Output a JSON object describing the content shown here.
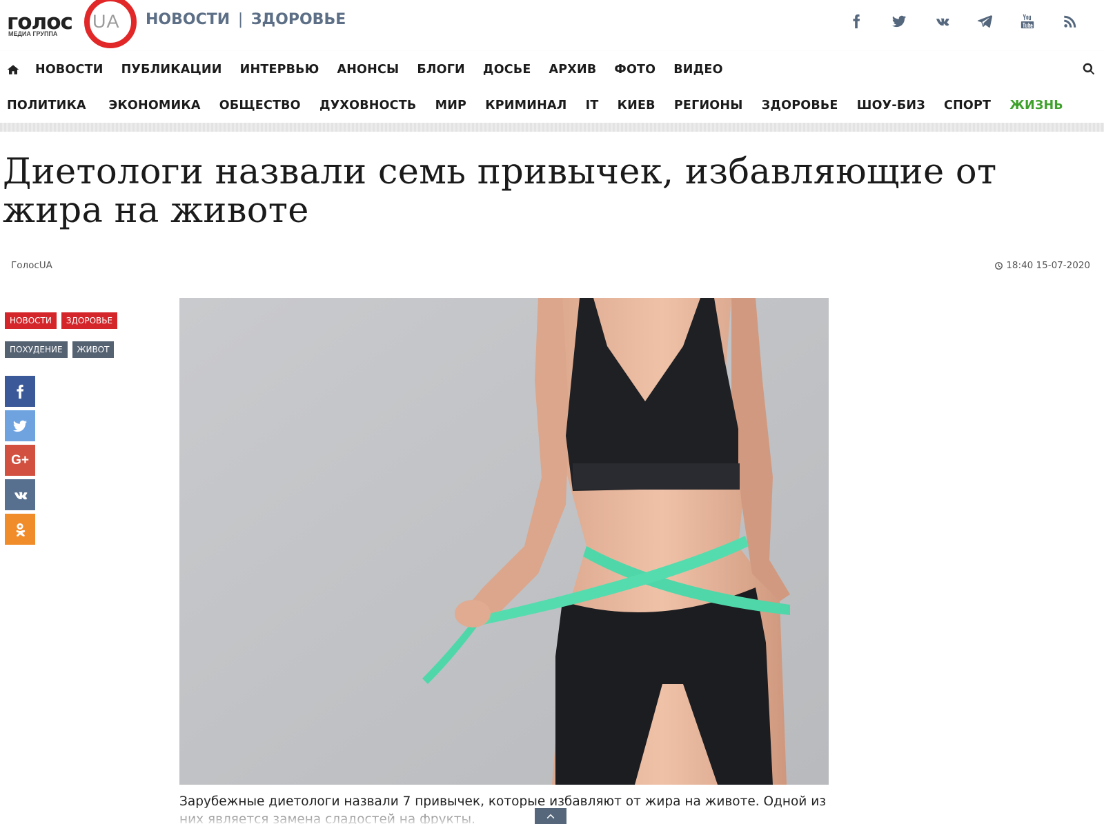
{
  "brand": {
    "logo_word": "голос",
    "logo_ua": "UA",
    "logo_sub": "МЕДИА ГРУППА"
  },
  "header": {
    "section_primary": "НОВОСТИ",
    "section_separator": "|",
    "section_secondary": "ЗДОРОВЬЕ",
    "social_icons": [
      "facebook-icon",
      "twitter-icon",
      "vk-icon",
      "telegram-icon",
      "youtube-icon",
      "rss-icon"
    ]
  },
  "main_nav": {
    "home_icon": "home-icon",
    "items": [
      "НОВОСТИ",
      "ПУБЛИКАЦИИ",
      "ИНТЕРВЬЮ",
      "АНОНСЫ",
      "БЛОГИ",
      "ДОСЬЕ",
      "АРХИВ",
      "ФОТО",
      "ВИДЕО"
    ],
    "search_icon": "search-icon"
  },
  "category_nav": {
    "items": [
      "ПОЛИТИКА",
      "ЭКОНОМИКА",
      "ОБЩЕСТВО",
      "ДУХОВНОСТЬ",
      "МИР",
      "КРИМИНАЛ",
      "IT",
      "КИЕВ",
      "РЕГИОНЫ",
      "ЗДОРОВЬЕ",
      "ШОУ-БИЗ",
      "СПОРТ",
      "ЖИЗНЬ"
    ],
    "active": "ЖИЗНЬ",
    "active_color": "#3fa12c"
  },
  "article": {
    "title": "Диетологи назвали семь привычек, избавляющие от жира на животе",
    "author": "ГолосUA",
    "datetime": "18:40 15-07-2020",
    "caption": "Зарубежные диетологи назвали 7 привычек, которые избавляют от жира на животе. Одной из них является замена сладостей на фрукты."
  },
  "tags": {
    "rubrics": [
      "НОВОСТИ",
      "ЗДОРОВЬЕ"
    ],
    "keywords": [
      "ПОХУДЕНИЕ",
      "ЖИВОТ"
    ],
    "rubric_color": "#d3252a",
    "keyword_color": "#556272"
  },
  "share": {
    "google_plus_label": "G+",
    "buttons": [
      "facebook-icon",
      "twitter-icon",
      "google-plus-icon",
      "vk-icon",
      "odnoklassniki-icon"
    ]
  },
  "colors": {
    "brand_red": "#e12727",
    "header_slate": "#5c6f86",
    "accent_green": "#3fa12c",
    "tape_green": "#4fd7a9"
  }
}
